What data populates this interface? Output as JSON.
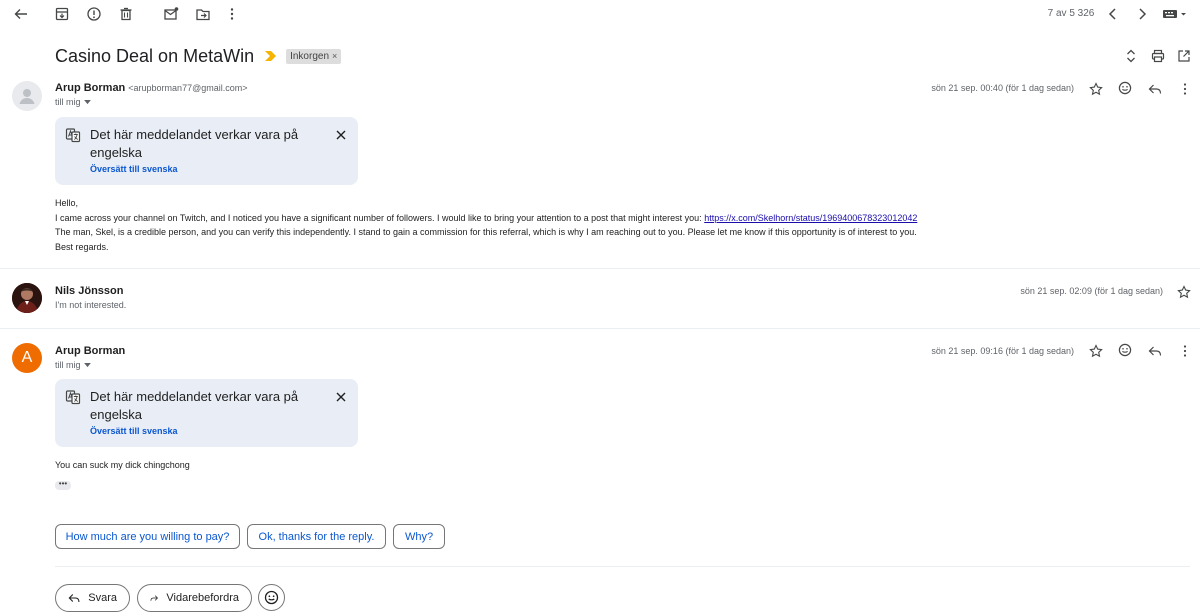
{
  "toolbar": {
    "counter": "7 av 5 326",
    "icons": [
      "back-arrow-icon",
      "archive-icon",
      "report-spam-icon",
      "delete-icon",
      "mark-unread-icon",
      "move-to-icon",
      "more-icon",
      "newer-icon",
      "older-icon",
      "keyboard-icon"
    ]
  },
  "thread": {
    "subject": "Casino Deal on MetaWin",
    "label": "Inkorgen",
    "label_close": "×"
  },
  "messages": [
    {
      "sender_name": "Arup Borman",
      "sender_email": "<arupborman77@gmail.com>",
      "to": "till mig",
      "date": "sön 21 sep. 00:40 (för 1 dag sedan)",
      "avatar": "default-avatar",
      "translate_text": "Det här meddelandet verkar vara på engelska",
      "translate_link": "Översätt till svenska",
      "body": {
        "line1": "Hello,",
        "line2_prefix": "I came across your channel on Twitch, and I noticed you have a significant number of followers. I would like to bring your attention to a post that might interest you: ",
        "link": "https://x.com/Skelhorn/status/1969400678323012042",
        "line3": "The man, Skel, is a credible person, and you can verify this independently. I stand to gain a commission for this referral, which is why I am reaching out to you. Please let me know if this opportunity is of interest to you.",
        "line4": "Best regards."
      }
    },
    {
      "sender_name": "Nils Jönsson",
      "snippet": "I'm not interested.",
      "date": "sön 21 sep. 02:09 (för 1 dag sedan)",
      "avatar": "photo-avatar"
    },
    {
      "sender_name": "Arup Borman",
      "avatar_letter": "A",
      "to": "till mig",
      "date": "sön 21 sep. 09:16 (för 1 dag sedan)",
      "translate_text": "Det här meddelandet verkar vara på engelska",
      "translate_link": "Översätt till svenska",
      "body": "You can suck my dick chingchong",
      "trimmed": "•••"
    }
  ],
  "smart_replies": [
    "How much are you willing to pay?",
    "Ok, thanks for the reply.",
    "Why?"
  ],
  "actions": {
    "reply": "Svara",
    "forward": "Vidarebefordra"
  },
  "colors": {
    "accent": "#0b57d0",
    "translate_bg": "#e9eef6",
    "avatar_orange": "#ef6c00",
    "important_marker": "#f4b400"
  }
}
